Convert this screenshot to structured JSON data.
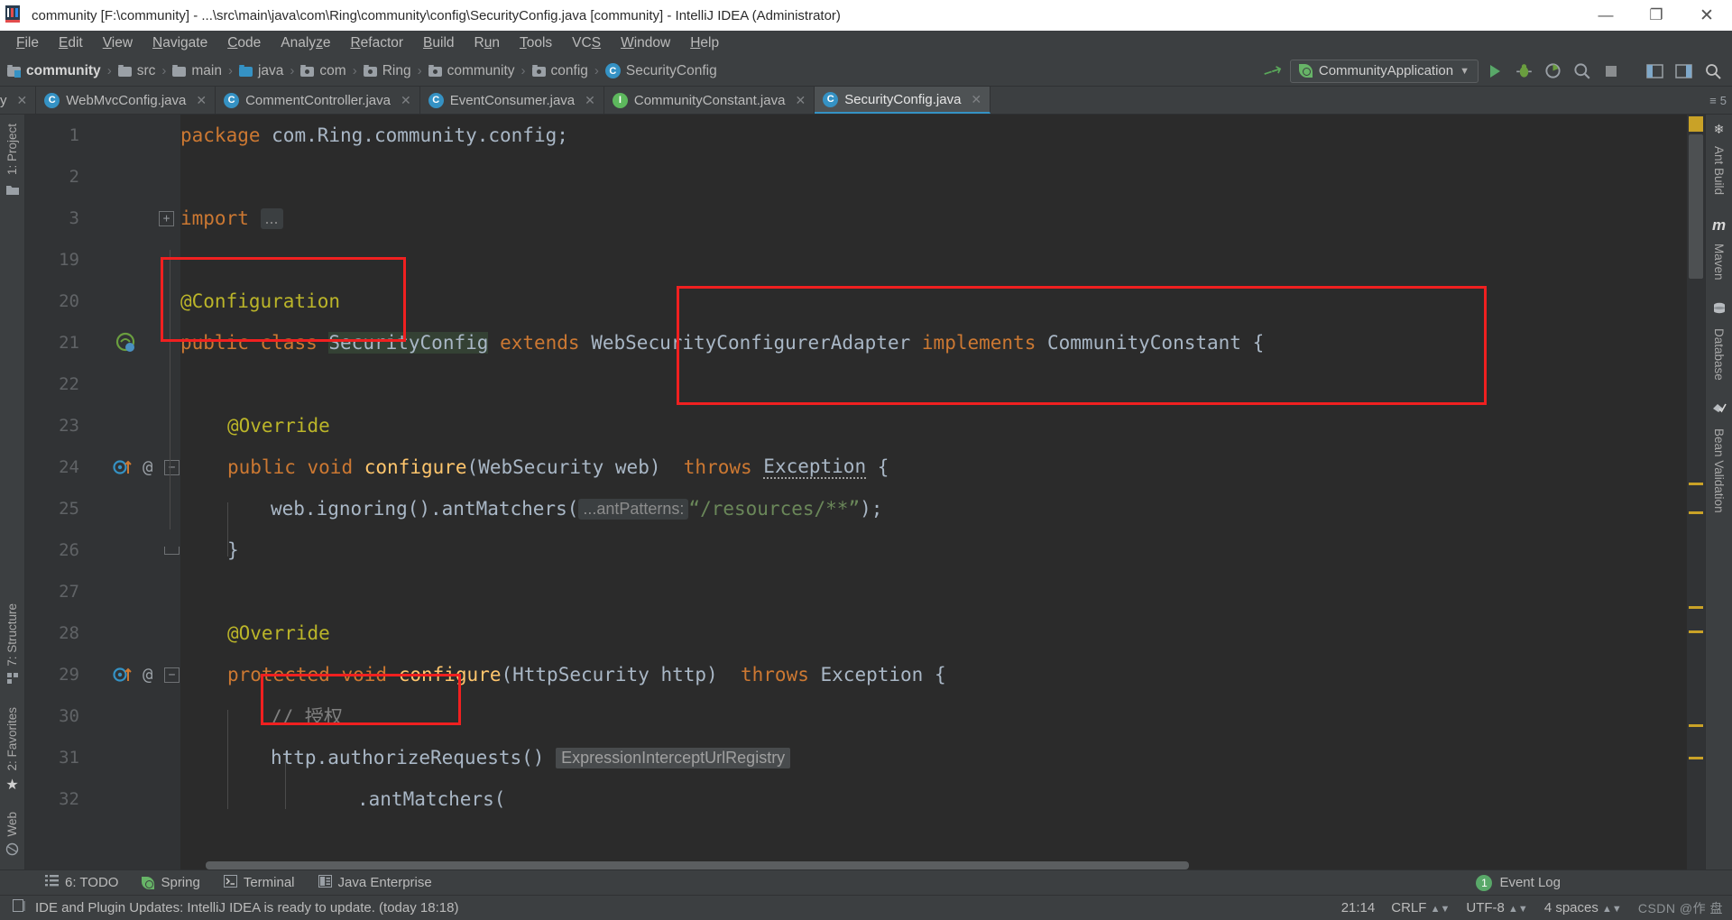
{
  "window": {
    "title": "community [F:\\community] - ...\\src\\main\\java\\com\\Ring\\community\\config\\SecurityConfig.java [community] - IntelliJ IDEA (Administrator)",
    "minimize": "—",
    "maximize": "❐",
    "close": "✕"
  },
  "menubar": {
    "items": [
      "File",
      "Edit",
      "View",
      "Navigate",
      "Code",
      "Analyze",
      "Refactor",
      "Build",
      "Run",
      "Tools",
      "VCS",
      "Window",
      "Help"
    ]
  },
  "breadcrumb": {
    "items": [
      {
        "label": "community",
        "icon": "project-folder-icon"
      },
      {
        "label": "src",
        "icon": "folder-icon"
      },
      {
        "label": "main",
        "icon": "folder-icon"
      },
      {
        "label": "java",
        "icon": "source-folder-icon"
      },
      {
        "label": "com",
        "icon": "package-icon"
      },
      {
        "label": "Ring",
        "icon": "package-icon"
      },
      {
        "label": "community",
        "icon": "package-icon"
      },
      {
        "label": "config",
        "icon": "package-icon"
      },
      {
        "label": "SecurityConfig",
        "icon": "class-icon"
      }
    ],
    "separator": "›"
  },
  "toolbar": {
    "run_config": "CommunityApplication",
    "run_config_caret": "▼",
    "build_icon": "hammer-icon",
    "run_label": "Run",
    "debug_label": "Debug",
    "coverage_label": "Run with Coverage",
    "profile_label": "Profile",
    "stop_label": "Stop",
    "search_label": "Search Everywhere"
  },
  "tabs": {
    "items": [
      {
        "label": "y",
        "icon": "class-icon",
        "active": false,
        "clipped": true
      },
      {
        "label": "WebMvcConfig.java",
        "icon": "class-icon",
        "active": false
      },
      {
        "label": "CommentController.java",
        "icon": "class-icon",
        "active": false
      },
      {
        "label": "EventConsumer.java",
        "icon": "class-icon",
        "active": false
      },
      {
        "label": "CommunityConstant.java",
        "icon": "interface-icon",
        "active": false
      },
      {
        "label": "SecurityConfig.java",
        "icon": "class-icon",
        "active": true
      }
    ],
    "close_glyph": "✕",
    "overflow_count": "5"
  },
  "left_tool_strip": {
    "items": [
      {
        "label": "1: Project",
        "icon": "project-icon"
      },
      {
        "label": "7: Structure",
        "icon": "structure-icon"
      },
      {
        "label": "2: Favorites",
        "icon": "star-icon"
      },
      {
        "label": "Web",
        "icon": "web-icon"
      }
    ]
  },
  "right_tool_strip": {
    "items": [
      {
        "label": "Ant Build",
        "icon": "ant-icon"
      },
      {
        "label": "Maven",
        "icon": "maven-icon"
      },
      {
        "label": "Database",
        "icon": "database-icon"
      },
      {
        "label": "Bean Validation",
        "icon": "bean-validation-icon"
      }
    ]
  },
  "editor": {
    "line_numbers": [
      "1",
      "2",
      "3",
      "19",
      "20",
      "21",
      "22",
      "23",
      "24",
      "25",
      "26",
      "27",
      "28",
      "29",
      "30",
      "31",
      "32"
    ],
    "lines": [
      {
        "num": "1",
        "segments": [
          {
            "t": "package",
            "c": "k"
          },
          {
            "t": " com.Ring.community.config;",
            "c": "pl"
          }
        ]
      },
      {
        "num": "2",
        "segments": []
      },
      {
        "num": "3",
        "segments": [
          {
            "t": "import",
            "c": "k"
          },
          {
            "t": " ",
            "c": "pl"
          },
          {
            "t": "...",
            "c": "fold"
          }
        ],
        "fold": "+"
      },
      {
        "num": "19",
        "segments": []
      },
      {
        "num": "20",
        "segments": [
          {
            "t": "@Configuration",
            "c": "an"
          }
        ]
      },
      {
        "num": "21",
        "segments": [
          {
            "t": "public",
            "c": "k"
          },
          {
            "t": " ",
            "c": "pl"
          },
          {
            "t": "class",
            "c": "k"
          },
          {
            "t": " ",
            "c": "pl"
          },
          {
            "t": "SecurityConfig",
            "c": "sel"
          },
          {
            "t": " ",
            "c": "pl"
          },
          {
            "t": "extends",
            "c": "k"
          },
          {
            "t": " WebSecurityConfigurerAdapter ",
            "c": "cls"
          },
          {
            "t": "implements",
            "c": "k"
          },
          {
            "t": " CommunityConstant {",
            "c": "cls"
          }
        ]
      },
      {
        "num": "22",
        "segments": []
      },
      {
        "num": "23",
        "segments": [
          {
            "t": "    @Override",
            "c": "an"
          }
        ]
      },
      {
        "num": "24",
        "segments": [
          {
            "t": "    ",
            "c": "pl"
          },
          {
            "t": "public",
            "c": "k"
          },
          {
            "t": " ",
            "c": "pl"
          },
          {
            "t": "void",
            "c": "k"
          },
          {
            "t": " ",
            "c": "pl"
          },
          {
            "t": "configure",
            "c": "mth"
          },
          {
            "t": "(WebSecurity web) ",
            "c": "cls"
          },
          {
            "t": "throws",
            "c": "k"
          },
          {
            "t": " ",
            "c": "pl"
          },
          {
            "t": "Exception",
            "c": "squig"
          },
          {
            "t": " {",
            "c": "cls"
          }
        ]
      },
      {
        "num": "25",
        "segments": [
          {
            "t": "        web.ignoring().antMatchers(",
            "c": "cls"
          },
          {
            "t": "...antPatterns:",
            "c": "hint"
          },
          {
            "t": " “/resources/**”",
            "c": "st"
          },
          {
            "t": ");",
            "c": "cls"
          }
        ]
      },
      {
        "num": "26",
        "segments": [
          {
            "t": "    }",
            "c": "cls"
          }
        ]
      },
      {
        "num": "27",
        "segments": []
      },
      {
        "num": "28",
        "segments": [
          {
            "t": "    @Override",
            "c": "an"
          }
        ]
      },
      {
        "num": "29",
        "segments": [
          {
            "t": "    ",
            "c": "pl"
          },
          {
            "t": "protected",
            "c": "k"
          },
          {
            "t": " ",
            "c": "pl"
          },
          {
            "t": "void",
            "c": "k"
          },
          {
            "t": " ",
            "c": "pl"
          },
          {
            "t": "configure",
            "c": "mth"
          },
          {
            "t": "(HttpSecurity http) ",
            "c": "cls"
          },
          {
            "t": "throws",
            "c": "k"
          },
          {
            "t": " Exception {",
            "c": "cls"
          }
        ]
      },
      {
        "num": "30",
        "segments": [
          {
            "t": "        // 授权",
            "c": "cm"
          }
        ]
      },
      {
        "num": "31",
        "segments": [
          {
            "t": "        http.authorizeRequests() ",
            "c": "cls"
          },
          {
            "t": "ExpressionInterceptUrlRegistry",
            "c": "hint2"
          }
        ]
      },
      {
        "num": "32",
        "segments": [
          {
            "t": "                .antMatchers(",
            "c": "cls"
          }
        ]
      }
    ],
    "code_text": {
      "l1": "package com.Ring.community.config;",
      "l3_import": "import",
      "l3_fold": "...",
      "l20": "@Configuration",
      "l21_public": "public",
      "l21_class": "class",
      "l21_name": "SecurityConfig",
      "l21_extends": "extends",
      "l21_super": "WebSecurityConfigurerAdapter",
      "l21_implements": "implements",
      "l21_iface": "CommunityConstant {",
      "l23": "@Override",
      "l24_public": "public",
      "l24_void": "void",
      "l24_mth": "configure",
      "l24_params": "(WebSecurity web)",
      "l24_throws": "throws",
      "l24_exc": "Exception",
      "l24_brace": "{",
      "l25_a": "web.ignoring().antMatchers(",
      "l25_hint": "...antPatterns:",
      "l25_str": "“/resources/**”",
      "l25_b": ");",
      "l26": "}",
      "l28": "@Override",
      "l29_protected": "protected",
      "l29_void": "void",
      "l29_mth": "configure",
      "l29_params": "(HttpSecurity http)",
      "l29_throws": "throws",
      "l29_exc": "Exception {",
      "l30_comment": "// 授权",
      "l31_a": "http.authorizeRequests()",
      "l31_hint": "ExpressionInterceptUrlRegistry",
      "l32": ".antMatchers("
    },
    "status_breadcrumb": "SecurityConfig"
  },
  "bottom_toolwindows": {
    "items": [
      {
        "label": "6: TODO",
        "icon": "todo-icon"
      },
      {
        "label": "Spring",
        "icon": "spring-leaf-icon"
      },
      {
        "label": "Terminal",
        "icon": "terminal-icon"
      },
      {
        "label": "Java Enterprise",
        "icon": "java-enterprise-icon"
      }
    ],
    "event_log": "Event Log",
    "event_count": "1"
  },
  "statusbar": {
    "message": "IDE and Plugin Updates: IntelliJ IDEA is ready to update. (today 18:18)",
    "position": "21:14",
    "line_separator": "CRLF",
    "encoding": "UTF-8",
    "indent": "4 spaces",
    "watermark": "CSDN @作 盘"
  },
  "colors": {
    "accent": "#3592c4",
    "annotation_red": "#f02020",
    "keyword": "#cc7832",
    "annotation": "#bbb529",
    "string": "#6a8759",
    "comment": "#808080",
    "editor_bg": "#2b2b2b",
    "chrome_bg": "#3c3f41",
    "green": "#59a869"
  }
}
